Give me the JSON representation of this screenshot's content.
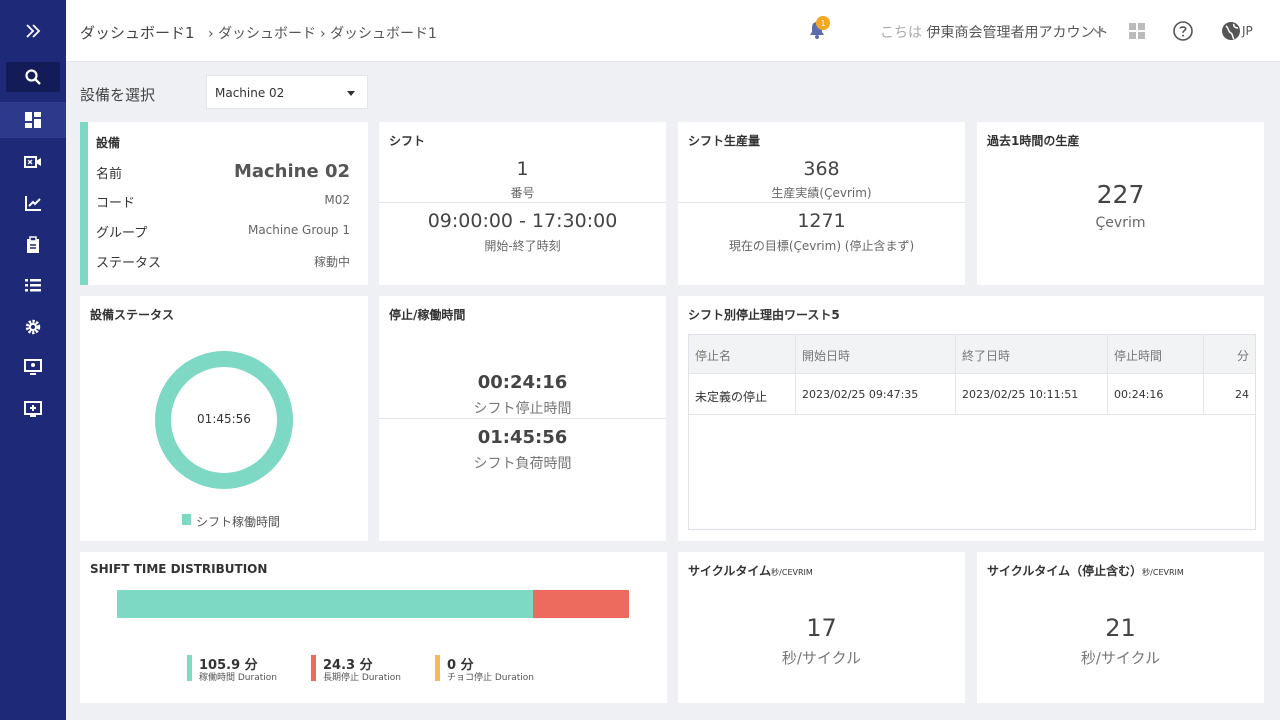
{
  "breadcrumb": {
    "title": "ダッシュボード1",
    "crumb_1": "ダッシュボード",
    "crumb_2": "ダッシュボード1"
  },
  "topbar": {
    "notification_count": "1",
    "greeting_prefix": "こちは",
    "account_name": "伊東商会管理者用アカウント",
    "language": "JP"
  },
  "device_select": {
    "label": "設備を選択",
    "value": "Machine 02"
  },
  "device_card": {
    "title": "設備",
    "name_label": "名前",
    "name_value": "Machine 02",
    "code_label": "コード",
    "code_value": "M02",
    "group_label": "グループ",
    "group_value": "Machine Group 1",
    "status_label": "ステータス",
    "status_value": "稼動中"
  },
  "shift_card": {
    "title": "シフト",
    "number": "1",
    "number_label": "番号",
    "time_range": "09:00:00 - 17:30:00",
    "time_label": "開始-終了時刻"
  },
  "production_card": {
    "title": "シフト生産量",
    "actual": "368",
    "actual_label": "生産実績(Çevrim)",
    "target": "1271",
    "target_label": "現在の目標(Çevrim) (停止含まず)"
  },
  "last_hour_card": {
    "title": "過去1時間の生産",
    "value": "227",
    "unit": "Çevrim"
  },
  "device_status_card": {
    "title": "設備ステータス",
    "donut_center": "01:45:56",
    "legend": "シフト稼働時間",
    "running_fraction": 1.0
  },
  "stop_card": {
    "title": "停止/稼働時間",
    "stop_time": "00:24:16",
    "stop_label": "シフト停止時間",
    "load_time": "01:45:56",
    "load_label": "シフト負荷時間"
  },
  "worst5_card": {
    "title": "シフト別停止理由ワースト5",
    "headers": [
      "停止名",
      "開始日時",
      "終了日時",
      "停止時間",
      "分"
    ],
    "rows": [
      [
        "未定義の停止",
        "2023/02/25 09:47:35",
        "2023/02/25 10:11:51",
        "00:24:16",
        "24"
      ]
    ]
  },
  "distribution_card": {
    "title": "SHIFT TIME DISTRIBUTION",
    "segments": [
      {
        "value": "105.9 分",
        "label": "稼働時間 Duration",
        "minutes": 105.9,
        "color": "#7dd8c4"
      },
      {
        "value": "24.3 分",
        "label": "長期停止 Duration",
        "minutes": 24.3,
        "color": "#ec6a5e"
      },
      {
        "value": "0 分",
        "label": "チョコ停止 Duration",
        "minutes": 0,
        "color": "#f5b95a"
      }
    ]
  },
  "cycle_card": {
    "title": "サイクルタイム",
    "title_suffix": "秒/CEVRIM",
    "value": "17",
    "unit": "秒/サイクル"
  },
  "cycle_stop_card": {
    "title": "サイクルタイム（停止含む）",
    "title_suffix": "秒/CEVRIM",
    "value": "21",
    "unit": "秒/サイクル"
  },
  "colors": {
    "sidebar": "#1e2a78",
    "accent": "#7dd8c4",
    "stop": "#ec6a5e",
    "warn": "#f5b95a"
  }
}
